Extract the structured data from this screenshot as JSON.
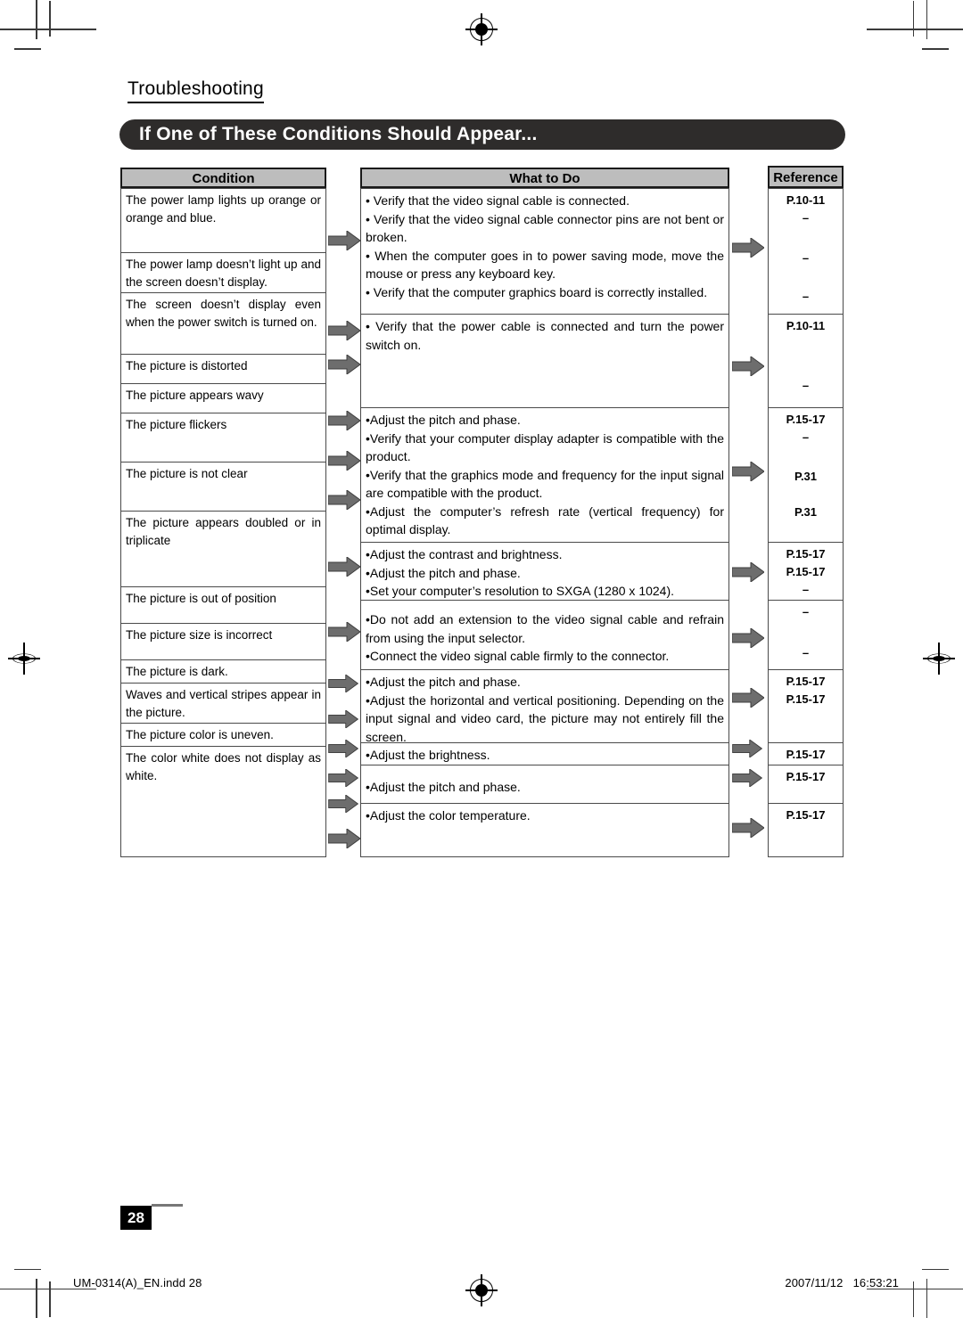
{
  "document": {
    "section_label": "Troubleshooting",
    "title": "If One of These Conditions Should Appear...",
    "page_number": "28",
    "footer_left": "UM-0314(A)_EN.indd   28",
    "footer_right": "2007/11/12   16:53:21"
  },
  "table": {
    "headers": {
      "condition": "Condition",
      "what_to_do": "What to Do",
      "reference": "Reference"
    },
    "conditions": [
      {
        "text": "The power lamp lights up orange or orange and blue."
      },
      {
        "text": "The power lamp doesn’t light up and the screen doesn’t display."
      },
      {
        "text": "The screen doesn’t display even when the power switch is turned on."
      },
      {
        "text": "The picture is distorted"
      },
      {
        "text": "The picture appears wavy"
      },
      {
        "text": "The picture flickers"
      },
      {
        "text": "The picture is not clear"
      },
      {
        "text": "The picture appears doubled or in triplicate"
      },
      {
        "text": "The picture is out of position"
      },
      {
        "text": "The picture size is incorrect"
      },
      {
        "text": "The picture is dark."
      },
      {
        "text": "Waves and vertical stripes appear in the picture."
      },
      {
        "text": "The picture color is uneven."
      },
      {
        "text": "The color white does not display as white."
      }
    ],
    "what_to_do": [
      {
        "lines": [
          "• Verify that the video signal cable is connected.",
          "• Verify that the video signal cable connector pins are not bent or broken.",
          "• When the computer goes in to power saving mode, move the mouse or press any keyboard key.",
          "• Verify that the computer graphics board is correctly installed."
        ]
      },
      {
        "lines": [
          "• Verify that the power cable is connected and turn the power switch on."
        ]
      },
      {
        "lines": [
          "•Adjust the pitch and phase.",
          "•Verify that your computer display adapter is compatible with the product.",
          "•Verify that the graphics mode and frequency for the input signal are compatible with the product.",
          "•Adjust the computer’s refresh rate (vertical frequency) for optimal display."
        ]
      },
      {
        "lines": [
          "•Adjust the contrast and brightness.",
          "•Adjust the pitch and phase.",
          "•Set your computer’s resolution to SXGA (1280 x 1024)."
        ]
      },
      {
        "lines": [
          "•Do not add an extension to the video signal cable and refrain from using the input selector.",
          "•Connect the video signal cable firmly to the connector."
        ]
      },
      {
        "lines": [
          "•Adjust the pitch and phase.",
          "•Adjust the horizontal and vertical positioning. Depending on the input signal and video card, the picture may not entirely fill the screen."
        ]
      },
      {
        "lines": [
          "•Adjust the brightness."
        ]
      },
      {
        "lines": [
          "•Adjust the pitch and phase."
        ]
      },
      {
        "lines": [
          "•Adjust the color temperature."
        ]
      }
    ],
    "references": [
      {
        "values": [
          "P.10-11",
          "–",
          "–",
          "–"
        ]
      },
      {
        "values": [
          "P.10-11",
          "–"
        ]
      },
      {
        "values": [
          "P.15-17",
          "–",
          "P.31",
          "P.31"
        ]
      },
      {
        "values": [
          "P.15-17",
          "P.15-17",
          "–"
        ]
      },
      {
        "values": [
          "–",
          "–"
        ]
      },
      {
        "values": [
          "P.15-17",
          "P.15-17"
        ]
      },
      {
        "values": [
          "P.15-17"
        ]
      },
      {
        "values": [
          "P.15-17"
        ]
      },
      {
        "values": [
          "P.15-17"
        ]
      }
    ]
  }
}
